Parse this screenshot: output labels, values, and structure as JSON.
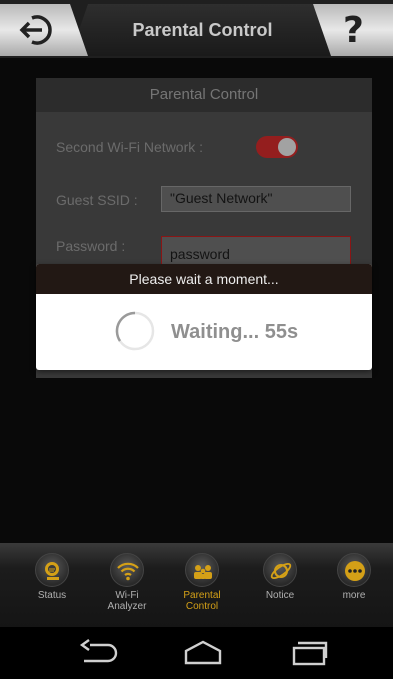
{
  "header": {
    "title": "Parental Control",
    "help_label": "?"
  },
  "panel": {
    "title": "Parental Control",
    "second_wifi_label": "Second Wi-Fi Network :",
    "second_wifi_enabled": true,
    "guest_ssid_label": "Guest SSID :",
    "guest_ssid_value": "\"Guest Network\"",
    "password_label": "Password :",
    "password_value": "password"
  },
  "dialog": {
    "title": "Please wait a moment...",
    "waiting_text": "Waiting... 55s"
  },
  "tabs": [
    {
      "label": "Status",
      "icon": "magnifier-icon"
    },
    {
      "label": "Wi-Fi\nAnalyzer",
      "icon": "wifi-icon"
    },
    {
      "label": "Parental\nControl",
      "icon": "family-icon",
      "active": true
    },
    {
      "label": "Notice",
      "icon": "planet-icon"
    },
    {
      "label": "more",
      "icon": "more-dots-icon"
    }
  ],
  "colors": {
    "accent": "#d4a017",
    "toggle_on": "#c62828",
    "dialog_title_bg": "#221814"
  }
}
